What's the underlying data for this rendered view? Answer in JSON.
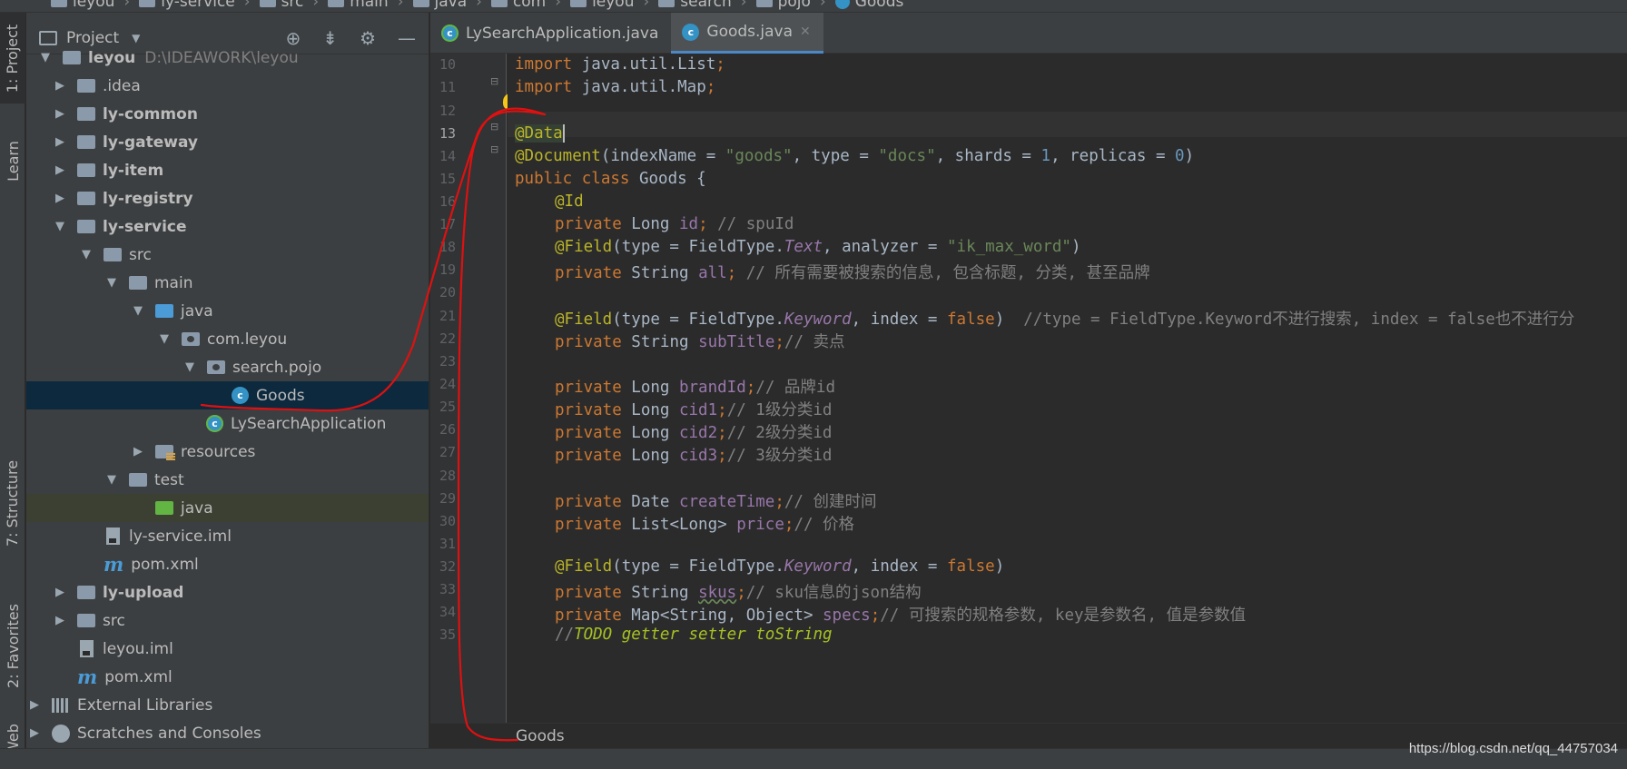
{
  "breadcrumbs": [
    "leyou",
    "ly-service",
    "src",
    "main",
    "java",
    "com",
    "leyou",
    "search",
    "pojo",
    "Goods"
  ],
  "stripe": {
    "top_tabs": [
      "1: Project",
      "Learn"
    ],
    "bottom_tabs": [
      "7: Structure",
      "2: Favorites",
      "Web"
    ]
  },
  "project_panel": {
    "title": "Project",
    "tree": [
      {
        "label": "leyou",
        "extra": "D:\\IDEAWORK\\leyou",
        "bold": true
      },
      {
        "label": ".idea"
      },
      {
        "label": "ly-common",
        "bold": true
      },
      {
        "label": "ly-gateway",
        "bold": true
      },
      {
        "label": "ly-item",
        "bold": true
      },
      {
        "label": "ly-registry",
        "bold": true
      },
      {
        "label": "ly-service",
        "bold": true
      },
      {
        "label": "src"
      },
      {
        "label": "main"
      },
      {
        "label": "java"
      },
      {
        "label": "com.leyou"
      },
      {
        "label": "search.pojo"
      },
      {
        "label": "Goods",
        "selected": true
      },
      {
        "label": "LySearchApplication"
      },
      {
        "label": "resources"
      },
      {
        "label": "test"
      },
      {
        "label": "java"
      },
      {
        "label": "ly-service.iml"
      },
      {
        "label": "pom.xml"
      },
      {
        "label": "ly-upload",
        "bold": true
      },
      {
        "label": "src"
      },
      {
        "label": "leyou.iml"
      },
      {
        "label": "pom.xml"
      },
      {
        "label": "External Libraries"
      },
      {
        "label": "Scratches and Consoles"
      }
    ]
  },
  "editor": {
    "tabs": [
      {
        "label": "LySearchApplication.java",
        "active": false
      },
      {
        "label": "Goods.java",
        "active": true
      }
    ],
    "line_numbers": [
      "10",
      "11",
      "12",
      "13",
      "14",
      "15",
      "16",
      "17",
      "18",
      "19",
      "20",
      "21",
      "22",
      "23",
      "24",
      "25",
      "26",
      "27",
      "28",
      "29",
      "30",
      "31",
      "32",
      "33",
      "34",
      "35"
    ],
    "code": {
      "l10_a": "import ",
      "l10_b": "java.util.List",
      "l10_c": ";",
      "l11_a": "import ",
      "l11_b": "java.util.Map",
      "l11_c": ";",
      "l13": "@Data",
      "l14_a": "@Document",
      "l14_b": "(indexName = ",
      "l14_c": "\"goods\"",
      "l14_d": ", type = ",
      "l14_e": "\"docs\"",
      "l14_f": ", shards = ",
      "l14_g": "1",
      "l14_h": ", replicas = ",
      "l14_i": "0",
      "l14_j": ")",
      "l15_a": "public class ",
      "l15_b": "Goods {",
      "l16": "@Id",
      "l17_a": "private ",
      "l17_b": "Long ",
      "l17_c": "id",
      "l17_d": "; ",
      "l17_e": "// spuId",
      "l18_a": "@Field",
      "l18_b": "(type = FieldType.",
      "l18_c": "Text",
      "l18_d": ", analyzer = ",
      "l18_e": "\"ik_max_word\"",
      "l18_f": ")",
      "l19_a": "private ",
      "l19_b": "String ",
      "l19_c": "all",
      "l19_d": "; ",
      "l19_e": "// 所有需要被搜索的信息, 包含标题, 分类, 甚至品牌",
      "l21_a": "@Field",
      "l21_b": "(type = FieldType.",
      "l21_c": "Keyword",
      "l21_d": ", index = ",
      "l21_e": "false",
      "l21_f": ")  ",
      "l21_g": "//type = FieldType.Keyword不进行搜索, index = false也不进行分",
      "l22_a": "private ",
      "l22_b": "String ",
      "l22_c": "subTitle",
      "l22_d": ";",
      "l22_e": "// 卖点",
      "l24_a": "private ",
      "l24_b": "Long ",
      "l24_c": "brandId",
      "l24_d": ";",
      "l24_e": "// 品牌id",
      "l25_a": "private ",
      "l25_b": "Long ",
      "l25_c": "cid1",
      "l25_d": ";",
      "l25_e": "// 1级分类id",
      "l26_a": "private ",
      "l26_b": "Long ",
      "l26_c": "cid2",
      "l26_d": ";",
      "l26_e": "// 2级分类id",
      "l27_a": "private ",
      "l27_b": "Long ",
      "l27_c": "cid3",
      "l27_d": ";",
      "l27_e": "// 3级分类id",
      "l29_a": "private ",
      "l29_b": "Date ",
      "l29_c": "createTime",
      "l29_d": ";",
      "l29_e": "// 创建时间",
      "l30_a": "private ",
      "l30_b": "List<Long> ",
      "l30_c": "price",
      "l30_d": ";",
      "l30_e": "// 价格",
      "l32_a": "@Field",
      "l32_b": "(type = FieldType.",
      "l32_c": "Keyword",
      "l32_d": ", index = ",
      "l32_e": "false",
      "l32_f": ")",
      "l33_a": "private ",
      "l33_b": "String ",
      "l33_c": "skus",
      "l33_d": ";",
      "l33_e": "// sku信息的json结构",
      "l34_a": "private ",
      "l34_b": "Map<String, Object> ",
      "l34_c": "specs",
      "l34_d": ";",
      "l34_e": "// 可搜索的规格参数, key是参数名, 值是参数值",
      "l35_a": "//",
      "l35_b": "TODO getter setter toString"
    },
    "breadcrumb": "Goods"
  },
  "watermark": "https://blog.csdn.net/qq_44757034",
  "colors": {
    "background": "#2b2b2b",
    "panel": "#3c3f41",
    "selection": "#0d293e",
    "keyword": "#cc7832",
    "annotation": "#bbb529",
    "string": "#6a8759",
    "number": "#6897bb",
    "field": "#9876aa",
    "comment": "#808080",
    "scribble": "#e01010"
  }
}
